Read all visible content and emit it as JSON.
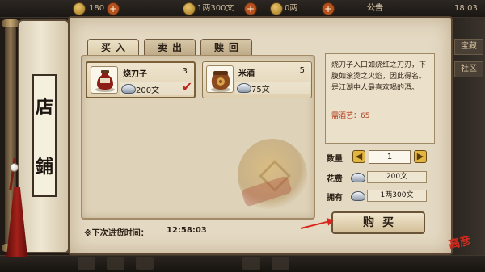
{
  "hud": {
    "left_value": "180",
    "middle_value": "1两300文",
    "right_value": "0两",
    "announcement_label": "公告",
    "clock": "18:03"
  },
  "side_buttons": [
    "宝藏",
    "社区"
  ],
  "shop": {
    "sign_top": "店",
    "sign_bottom": "鋪",
    "tabs": [
      {
        "label": "买入",
        "active": true
      },
      {
        "label": "卖出",
        "active": false
      },
      {
        "label": "赎回",
        "active": false
      }
    ],
    "items": [
      {
        "name": "烧刀子",
        "qty": "3",
        "price": "200文",
        "selected": true,
        "icon": "wine-jug-icon"
      },
      {
        "name": "米酒",
        "qty": "5",
        "price": "75文",
        "selected": false,
        "icon": "rice-wine-jar-icon"
      }
    ],
    "description": "烧刀子入口如烧红之刀刃，下腹如滚烫之火焰，因此得名。是江湖中人最喜欢喝的酒。",
    "skill_requirement": "需酒艺：65",
    "quantity_label": "数量",
    "quantity_value": "1",
    "cost_label": "花费",
    "cost_value": "200文",
    "owned_label": "拥有",
    "owned_value": "1两300文",
    "buy_label": "购买",
    "restock_label": "※下次进货时间：",
    "restock_time": "12:58:03",
    "seal_text": "高彦"
  },
  "colors": {
    "accent_red": "#d9251d",
    "paper": "#e4d9c2",
    "frame": "#5a4632"
  }
}
